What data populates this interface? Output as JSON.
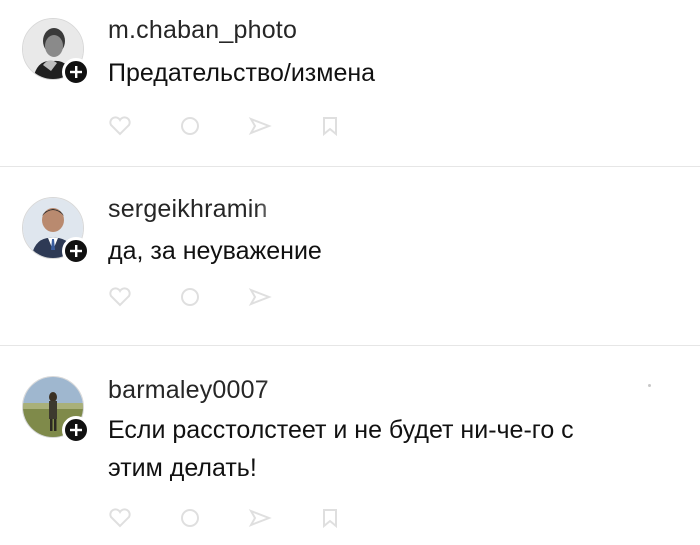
{
  "posts": [
    {
      "username": "m.chaban_photo",
      "comment": "Предательство/измена",
      "avatar_icon": "user-portrait-bw",
      "follow_icon": "plus-icon"
    },
    {
      "username": "sergeikhramin",
      "comment": "да, за  неуважение",
      "avatar_icon": "user-portrait-suit",
      "follow_icon": "plus-icon"
    },
    {
      "username": "barmaley0007",
      "comment_line1": "Если расстолстеет и не будет ни-че-го с",
      "comment_line2": "этим делать!",
      "avatar_icon": "user-portrait-field",
      "follow_icon": "plus-icon"
    }
  ],
  "colors": {
    "background": "#ffffff",
    "text": "#111111",
    "badge": "#111111",
    "divider": "#e6e6e6"
  }
}
